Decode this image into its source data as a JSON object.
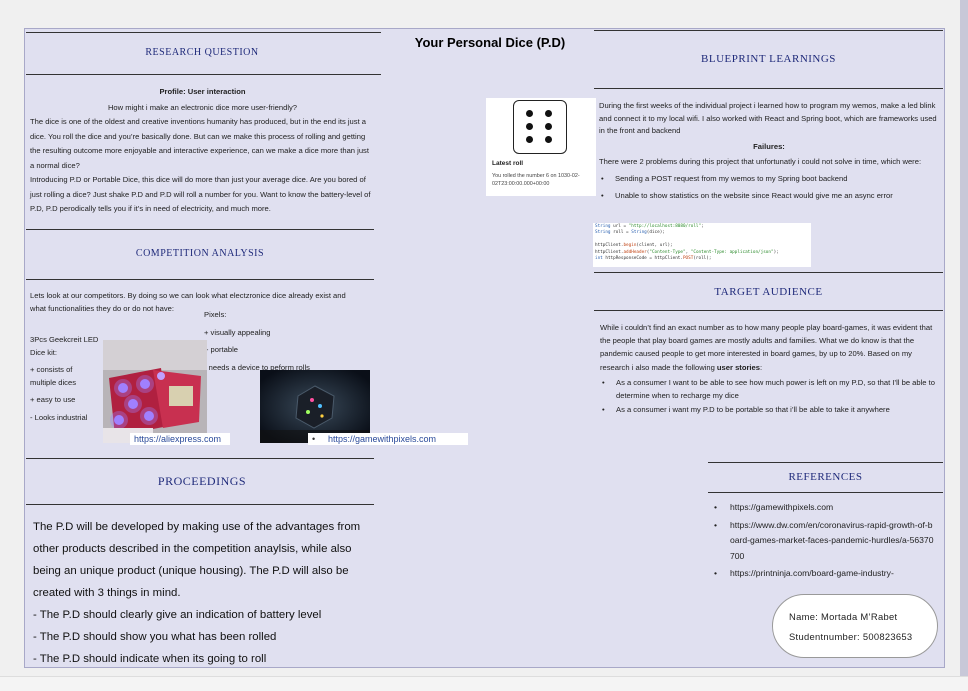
{
  "title": "Your Personal Dice (P.D)",
  "research": {
    "heading": "RESEARCH QUESTION",
    "profile": "Profile: User interaction",
    "question": "How might i make an electronic dice more user-friendly?",
    "p1": "The dice is one of the oldest and creative inventions humanity has produced, but in the end its just a dice. You roll the dice and you’re basically done. But can we make this process of rolling and getting the resulting outcome more enjoyable and interactive experience, can we make a dice more than just a normal dice?",
    "p2": "Introducing P.D or Portable Dice, this dice will do more than just your average dice. Are you bored of just rolling a dice? Just shake P.D and P.D will roll a number for you. Want to know the battery-level of P.D, P.D perodically tells you if it’s in need of electricity, and much more."
  },
  "competition": {
    "heading": "COMPETITION ANALYSIS",
    "intro": "Lets look at our competitors. By doing so we can look what electzronice dice already exist and what functionalities they do or do not have:",
    "geekcreit_title": "3Pcs Geekcreit LED Dice kit:",
    "geekcreit_items": [
      "+ consists of multiple dices",
      "+ easy to use",
      "- Looks industrial"
    ],
    "pixels_title": "Pixels:",
    "pixels_items": [
      "+ visually appealing",
      "+ portable",
      "- needs a device to peform rolls"
    ],
    "link1": "https://aliexpress.com",
    "link2": "https://gamewithpixels.com"
  },
  "proceedings": {
    "heading": "PROCEEDINGS",
    "intro": "The P.D will be developed by making use of the advantages from other products described in the competition anaylsis, while also being an unique product  (unique housing).  The P.D will also be created with 3 things in mind.",
    "items": [
      "- The P.D should clearly give an indication of battery level",
      "- The P.D should show you what has been rolled",
      "- The P.D should indicate when its going to roll"
    ]
  },
  "dice_card": {
    "label": "Latest roll",
    "text": "You rolled the number 6 on 1030-02-02T23:00:00.000+00:00"
  },
  "blueprint": {
    "heading": "BLUEPRINT LEARNINGS",
    "p1": "During the first weeks of the individual project i learned how to program my wemos, make a led blink and connect it to my local wifi. I also worked with React and Spring boot, which are  frameworks used in the front and backend",
    "failures_label": "Failures:",
    "p2": "There were 2 problems during this project that unfortunatly i could not solve in time, which were:",
    "items": [
      "Sending a POST request from my wemos to my Spring boot backend",
      "Unable to show statistics on the website since React would give me an async error"
    ],
    "code": [
      "String url = \"http://localhost:8080/roll\";",
      "String roll = String(dice);",
      "",
      "httpClient.begin(client, url);",
      "httpClient.addHeader(\"Content-Type\", \"Content-Type: application/json\");",
      "int httpResponseCode = httpClient.POST(roll);"
    ]
  },
  "audience": {
    "heading": "TARGET AUDIENCE",
    "p1_start": "While i couldn’t find an exact number as to how many people play board-games, it was evident that the people that play board games are mostly adults and families. What we do know is that the pandemic caused people to get more interested in board games, by up to 20%. Based on my research i also made the following ",
    "p1_bold": "user stories",
    "p1_end": ":",
    "stories": [
      "As a consumer I want to be able to see how much power is left on my P.D, so that I’ll be able to determine when to recharge my dice",
      "As a consumer i want my P.D to be portable so that i’ll be able to take it anywhere"
    ]
  },
  "references": {
    "heading": "REFERENCES",
    "items": [
      "https://gamewithpixels.com",
      "https://www.dw.com/en/coronavirus-rapid-growth-of-board-games-market-faces-pandemic-hurdles/a-56370700",
      "https://printninja.com/board-game-industry-"
    ]
  },
  "author": {
    "name": "Name:  Mortada M’Rabet",
    "student": "Studentnumber: 500823653"
  },
  "colors": {
    "heading": "#1f2a7a",
    "background": "#e0e0f0"
  }
}
